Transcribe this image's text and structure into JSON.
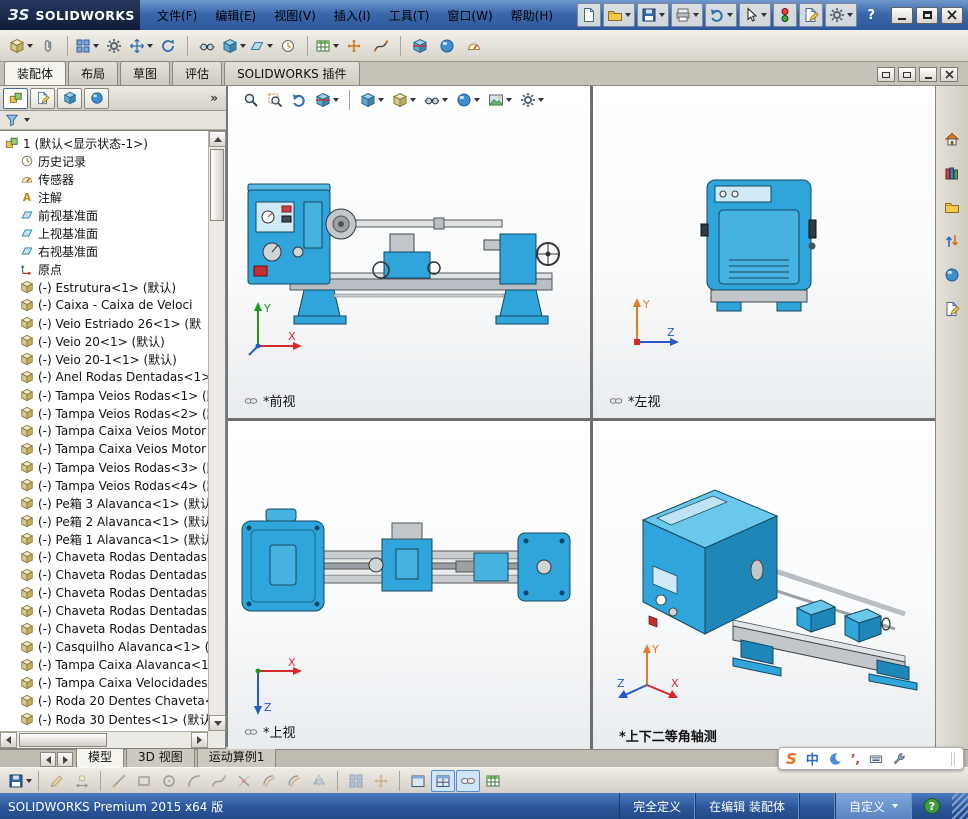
{
  "colors": {
    "machine_blue": "#2FA5DB",
    "titlebar_blue": "#3A68AB",
    "status_blue": "#2C5698",
    "accent_orange": "#F26B1D"
  },
  "title_bar": {
    "logo_mark": "ЗS",
    "logo_text": "SOLIDWORKS",
    "menus": [
      "文件(F)",
      "编辑(E)",
      "视图(V)",
      "插入(I)",
      "工具(T)",
      "窗口(W)",
      "帮助(H)"
    ],
    "tools": [
      "new-document",
      "open-document",
      "save-document",
      "print-document",
      "undo",
      "select",
      "rebuild",
      "file-properties",
      "options"
    ],
    "help_glyph": "?"
  },
  "assembly_toolbar": {
    "icons": [
      "insert-components",
      "mate",
      "linear-component-pattern",
      "smart-fasteners",
      "move-component",
      "rotate-component",
      "show-hidden-components",
      "assembly-features",
      "reference-geometry",
      "new-motion-study",
      "bill-of-materials",
      "exploded-view",
      "explode-line-sketch",
      "interference-detection",
      "assembly-visualization",
      "large-assembly-mode"
    ]
  },
  "command_tabs": {
    "items": [
      {
        "label": "装配体",
        "active": true
      },
      {
        "label": "布局",
        "active": false
      },
      {
        "label": "草图",
        "active": false
      },
      {
        "label": "评估",
        "active": false
      },
      {
        "label": "SOLIDWORKS 插件",
        "active": false
      }
    ]
  },
  "feature_panel": {
    "tabs": [
      "featuremanager",
      "propertymanager",
      "configurationmanager",
      "displaymanager"
    ],
    "chevron": "»"
  },
  "feature_tree": {
    "items": [
      {
        "label": "1 (默认<显示状态-1>)"
      },
      {
        "label": "历史记录"
      },
      {
        "label": "传感器"
      },
      {
        "label": "注解"
      },
      {
        "label": "前视基准面"
      },
      {
        "label": "上视基准面"
      },
      {
        "label": "右视基准面"
      },
      {
        "label": "原点"
      },
      {
        "label": "(-) Estrutura<1> (默认)"
      },
      {
        "label": "(-) Caixa - Caixa de Veloci"
      },
      {
        "label": "(-) Veio Estriado 26<1> (默"
      },
      {
        "label": "(-) Veio 20<1> (默认)"
      },
      {
        "label": "(-) Veio 20-1<1> (默认)"
      },
      {
        "label": "(-) Anel Rodas Dentadas<1>"
      },
      {
        "label": "(-) Tampa Veios Rodas<1> (默"
      },
      {
        "label": "(-) Tampa Veios Rodas<2> (默"
      },
      {
        "label": "(-) Tampa Caixa Veios Motor"
      },
      {
        "label": "(-) Tampa Caixa Veios Motor"
      },
      {
        "label": "(-) Tampa Veios Rodas<3> (默"
      },
      {
        "label": "(-) Tampa Veios Rodas<4> (默"
      },
      {
        "label": "(-) Pe箱 3 Alavanca<1> (默认"
      },
      {
        "label": "(-) Pe箱 2 Alavanca<1> (默认"
      },
      {
        "label": "(-) Pe箱 1 Alavanca<1> (默认"
      },
      {
        "label": "(-) Chaveta Rodas Dentadas<"
      },
      {
        "label": "(-) Chaveta Rodas Dentadas<"
      },
      {
        "label": "(-) Chaveta Rodas Dentadas<"
      },
      {
        "label": "(-) Chaveta Rodas Dentadas<"
      },
      {
        "label": "(-) Chaveta Rodas Dentadas<"
      },
      {
        "label": "(-) Casquilho Alavanca<1> ("
      },
      {
        "label": "(-) Tampa Caixa Alavanca<1>"
      },
      {
        "label": "(-) Tampa Caixa Velocidades"
      },
      {
        "label": "(-) Roda 20 Dentes Chaveta<"
      },
      {
        "label": "(-) Roda 30 Dentes<1> (默认"
      }
    ]
  },
  "headsup_toolbar": {
    "icons": [
      "zoom-to-fit",
      "zoom-to-area",
      "previous-view",
      "section-view",
      "view-orientation",
      "display-style",
      "hide-show-items",
      "edit-appearance",
      "apply-scene",
      "view-settings"
    ]
  },
  "viewports": [
    {
      "label": "*前视",
      "axes": [
        "Y",
        "X"
      ]
    },
    {
      "label": "*左视",
      "axes": [
        "Y",
        "Z"
      ]
    },
    {
      "label": "*上视",
      "axes": [
        "X",
        "Z"
      ]
    },
    {
      "label": "*上下二等角轴测",
      "axes": [
        "Y",
        "X",
        "Z"
      ]
    }
  ],
  "task_pane": {
    "icons": [
      "solidworks-resources",
      "design-library",
      "file-explorer",
      "view-palette",
      "appearances-scenes",
      "custom-properties"
    ]
  },
  "document_tabs": {
    "items": [
      {
        "label": "模型",
        "active": true
      },
      {
        "label": "3D 视图",
        "active": false
      },
      {
        "label": "运动算例1",
        "active": false
      }
    ]
  },
  "bottom_toolbar": {
    "icons": [
      "save",
      "sketch",
      "smart-dimension",
      "line",
      "rectangle",
      "circle",
      "arc",
      "spline",
      "trim-entities",
      "convert-entities",
      "offset-entities",
      "mirror-entities",
      "grid-system",
      "snap",
      "single-view",
      "four-view",
      "linked-views",
      "bom-table"
    ]
  },
  "status_bar": {
    "product": "SOLIDWORKS Premium 2015 x64 版",
    "fully_defined": "完全定义",
    "editing": "在编辑 装配体",
    "customize": "自定义",
    "help_glyph": "?"
  },
  "ime_bar": {
    "logo": "S",
    "mode": "中",
    "punctuation": "’,"
  }
}
